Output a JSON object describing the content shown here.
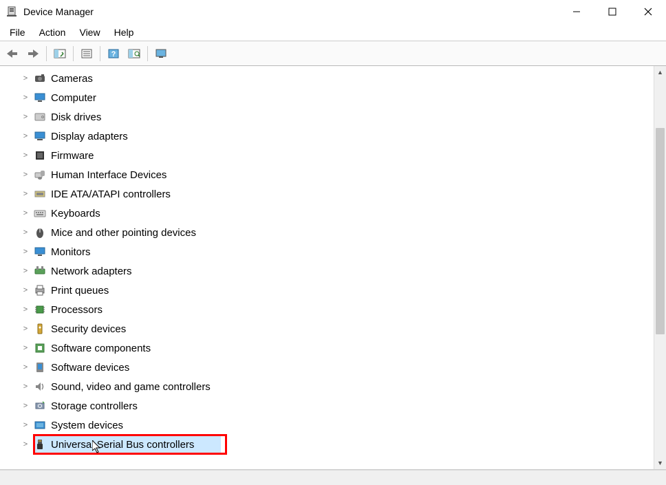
{
  "window": {
    "title": "Device Manager"
  },
  "menu": {
    "file": "File",
    "action": "Action",
    "view": "View",
    "help": "Help"
  },
  "tree": {
    "items": [
      {
        "label": "Cameras",
        "icon": "camera",
        "highlight": false
      },
      {
        "label": "Computer",
        "icon": "computer",
        "highlight": false
      },
      {
        "label": "Disk drives",
        "icon": "disk",
        "highlight": false
      },
      {
        "label": "Display adapters",
        "icon": "display",
        "highlight": false
      },
      {
        "label": "Firmware",
        "icon": "firmware",
        "highlight": false
      },
      {
        "label": "Human Interface Devices",
        "icon": "hid",
        "highlight": false
      },
      {
        "label": "IDE ATA/ATAPI controllers",
        "icon": "ide",
        "highlight": false
      },
      {
        "label": "Keyboards",
        "icon": "keyboard",
        "highlight": false
      },
      {
        "label": "Mice and other pointing devices",
        "icon": "mouse",
        "highlight": false
      },
      {
        "label": "Monitors",
        "icon": "monitor",
        "highlight": false
      },
      {
        "label": "Network adapters",
        "icon": "network",
        "highlight": false
      },
      {
        "label": "Print queues",
        "icon": "printer",
        "highlight": false
      },
      {
        "label": "Processors",
        "icon": "cpu",
        "highlight": false
      },
      {
        "label": "Security devices",
        "icon": "security",
        "highlight": false
      },
      {
        "label": "Software components",
        "icon": "software",
        "highlight": false
      },
      {
        "label": "Software devices",
        "icon": "softdev",
        "highlight": false
      },
      {
        "label": "Sound, video and game controllers",
        "icon": "sound",
        "highlight": false
      },
      {
        "label": "Storage controllers",
        "icon": "storage",
        "highlight": false
      },
      {
        "label": "System devices",
        "icon": "system",
        "highlight": false
      },
      {
        "label": "Universal Serial Bus controllers",
        "icon": "usb",
        "highlight": true
      }
    ]
  }
}
